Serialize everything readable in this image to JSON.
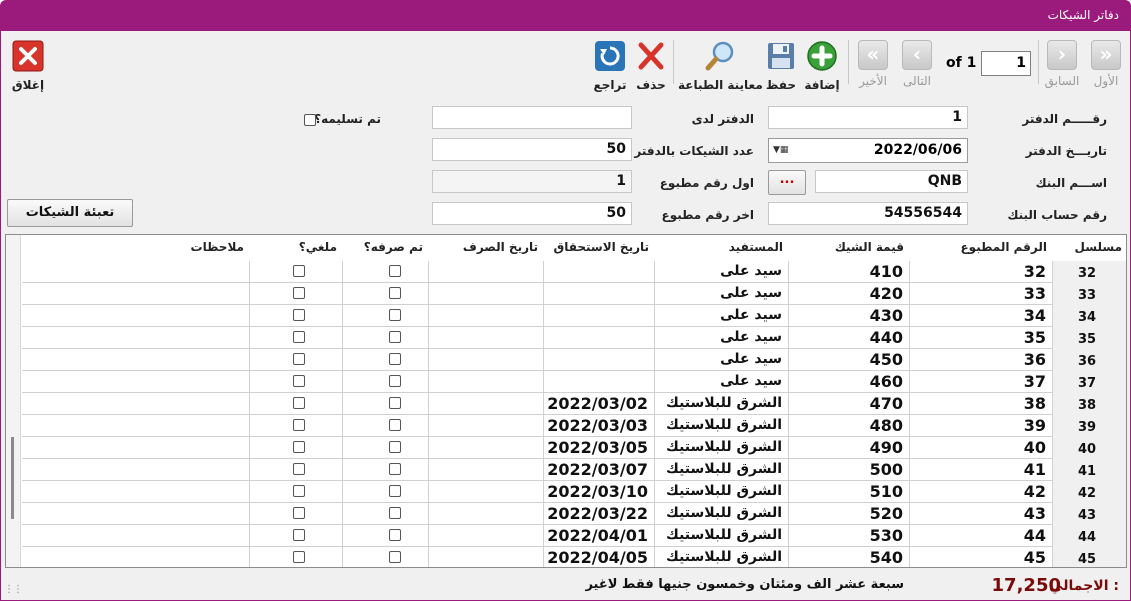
{
  "window": {
    "title": "دفاتر الشيكات"
  },
  "toolbar": {
    "close_label": "إغلاق",
    "revert_label": "تراجع",
    "delete_label": "حذف",
    "preview_label": "معاينة الطباعة",
    "save_label": "حفظ",
    "add_label": "إضافة",
    "last_label": "الأخير",
    "next_label": "التالى",
    "prev_label": "السابق",
    "first_label": "الأول",
    "page_current": "1",
    "page_of": "of 1"
  },
  "form": {
    "book_no_label": "رقـــــم الدفتر",
    "book_no": "1",
    "book_date_label": "تاريـــخ الدفتر",
    "book_date": "2022/06/06",
    "bank_name_label": "اســـم البنك",
    "bank_name": "QNB",
    "bank_account_label": "رقم حساب البنك",
    "bank_account": "54556544",
    "holder_label": "الدفتر لدى",
    "holder": "",
    "checks_count_label": "عدد الشيكات بالدفتر",
    "checks_count": "50",
    "first_printed_label": "اول رقم مطبوع",
    "first_printed": "1",
    "last_printed_label": "اخر رقم مطبوع",
    "last_printed": "50",
    "delivered_label": "تم تسليمه؟",
    "delivered": false,
    "dots_label": "...",
    "fill_button_label": "تعبئة الشيكات"
  },
  "grid": {
    "columns": {
      "serial": "مسلسل",
      "printed_no": "الرقم المطبوع",
      "value": "قيمة الشيك",
      "beneficiary": "المستفيد",
      "due_date": "تاريخ الاستحقاق",
      "paid_date": "تاريخ الصرف",
      "paid": "تم صرفه؟",
      "cancelled": "ملغي؟",
      "notes": "ملاحظات"
    },
    "rows": [
      {
        "serial": "32",
        "printed_no": "32",
        "value": "410",
        "beneficiary": "سيد على",
        "due_date": "",
        "paid_date": "",
        "notes": ""
      },
      {
        "serial": "33",
        "printed_no": "33",
        "value": "420",
        "beneficiary": "سيد على",
        "due_date": "",
        "paid_date": "",
        "notes": ""
      },
      {
        "serial": "34",
        "printed_no": "34",
        "value": "430",
        "beneficiary": "سيد على",
        "due_date": "",
        "paid_date": "",
        "notes": ""
      },
      {
        "serial": "35",
        "printed_no": "35",
        "value": "440",
        "beneficiary": "سيد على",
        "due_date": "",
        "paid_date": "",
        "notes": ""
      },
      {
        "serial": "36",
        "printed_no": "36",
        "value": "450",
        "beneficiary": "سيد على",
        "due_date": "",
        "paid_date": "",
        "notes": ""
      },
      {
        "serial": "37",
        "printed_no": "37",
        "value": "460",
        "beneficiary": "سيد على",
        "due_date": "",
        "paid_date": "",
        "notes": ""
      },
      {
        "serial": "38",
        "printed_no": "38",
        "value": "470",
        "beneficiary": "الشرق للبلاستيك",
        "due_date": "2022/03/02",
        "paid_date": "",
        "notes": ""
      },
      {
        "serial": "39",
        "printed_no": "39",
        "value": "480",
        "beneficiary": "الشرق للبلاستيك",
        "due_date": "2022/03/03",
        "paid_date": "",
        "notes": ""
      },
      {
        "serial": "40",
        "printed_no": "40",
        "value": "490",
        "beneficiary": "الشرق للبلاستيك",
        "due_date": "2022/03/05",
        "paid_date": "",
        "notes": ""
      },
      {
        "serial": "41",
        "printed_no": "41",
        "value": "500",
        "beneficiary": "الشرق للبلاستيك",
        "due_date": "2022/03/07",
        "paid_date": "",
        "notes": ""
      },
      {
        "serial": "42",
        "printed_no": "42",
        "value": "510",
        "beneficiary": "الشرق للبلاستيك",
        "due_date": "2022/03/10",
        "paid_date": "",
        "notes": ""
      },
      {
        "serial": "43",
        "printed_no": "43",
        "value": "520",
        "beneficiary": "الشرق للبلاستيك",
        "due_date": "2022/03/22",
        "paid_date": "",
        "notes": ""
      },
      {
        "serial": "44",
        "printed_no": "44",
        "value": "530",
        "beneficiary": "الشرق للبلاستيك",
        "due_date": "2022/04/01",
        "paid_date": "",
        "notes": ""
      },
      {
        "serial": "45",
        "printed_no": "45",
        "value": "540",
        "beneficiary": "الشرق للبلاستيك",
        "due_date": "2022/04/05",
        "paid_date": "",
        "notes": ""
      }
    ]
  },
  "status": {
    "total_label": "الاجمالي :",
    "total_value": "17,250",
    "total_words": "سبعة عشر الف ومئتان وخمسون جنيها فقط لاغير"
  },
  "icons": {
    "close": "close-x-icon",
    "revert": "undo-icon",
    "delete": "delete-x-icon",
    "preview": "magnifier-icon",
    "save": "floppy-disk-icon",
    "add": "plus-circle-icon",
    "last": "double-chevron-left-icon",
    "next": "chevron-left-icon",
    "prev": "chevron-right-icon",
    "first": "double-chevron-right-icon"
  },
  "colors": {
    "title_bar": "#9b1b7d",
    "total_text": "#7a0a0a",
    "close_red": "#d9342b",
    "add_green": "#3aa13a",
    "revert_blue": "#2a74b8"
  }
}
